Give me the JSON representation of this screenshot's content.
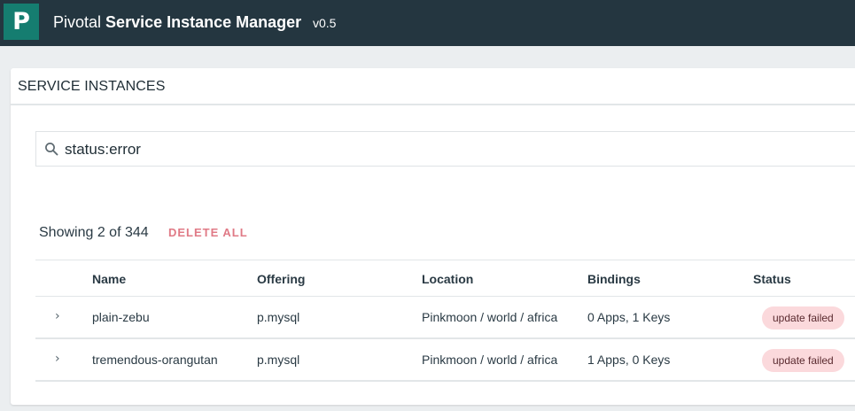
{
  "header": {
    "logo_letter": "P",
    "brand": "Pivotal",
    "product": "Service Instance Manager",
    "version": "v0.5",
    "background": "#243640",
    "logo_color": "#157d70"
  },
  "card": {
    "title": "SERVICE INSTANCES"
  },
  "search": {
    "icon": "search-icon",
    "value": "status:error"
  },
  "summary": {
    "showing": "Showing 2 of 344",
    "delete_all": "DELETE ALL",
    "delete_color": "#e07a86"
  },
  "table": {
    "columns": [
      "Name",
      "Offering",
      "Location",
      "Bindings",
      "Status"
    ],
    "rows": [
      {
        "expand_icon": "chevron-right-icon",
        "name": "plain-zebu",
        "offering": "p.mysql",
        "location": "Pinkmoon / world / africa",
        "bindings": "0 Apps, 1 Keys",
        "status": "update failed"
      },
      {
        "expand_icon": "chevron-right-icon",
        "name": "tremendous-orangutan",
        "offering": "p.mysql",
        "location": "Pinkmoon / world / africa",
        "bindings": "1 Apps, 0 Keys",
        "status": "update failed"
      }
    ],
    "status_badge_color": "#fbd9dc"
  }
}
